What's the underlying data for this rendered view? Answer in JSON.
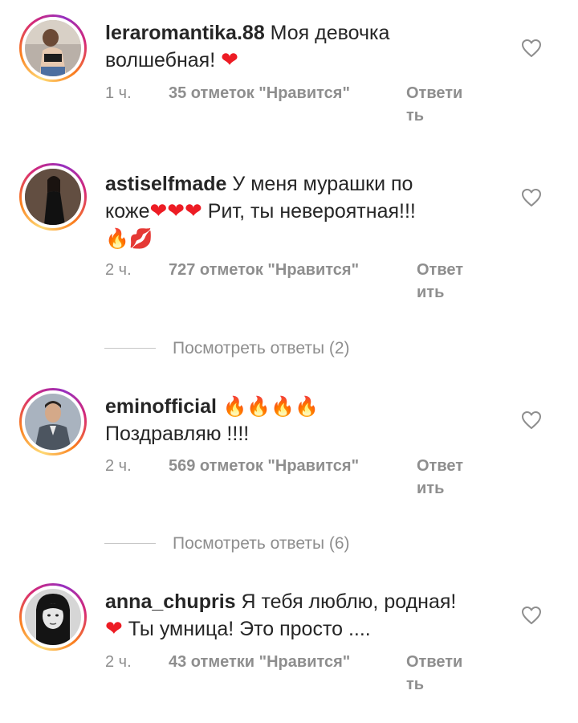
{
  "comments": [
    {
      "username": "leraromantika.88",
      "text_line1": " Моя девочка",
      "text_line2": "волшебная! ",
      "emoji_line2": "❤",
      "time": "1 ч.",
      "likes": "35 отметок \"Нравится\"",
      "reply_line1": "Ответи",
      "reply_line2": "ть"
    },
    {
      "username": "astiselfmade",
      "text_line1": " У меня мурашки по",
      "text_line2a": "коже",
      "emoji_line2": "❤❤❤",
      "text_line2b": " Рит, ты невероятная!!!",
      "emoji_line3": "🔥💋",
      "time": "2 ч.",
      "likes": "727 отметок \"Нравится\"",
      "reply_line1": "Ответ",
      "reply_line2": "ить"
    },
    {
      "username": "eminofficial",
      "emoji_line1": " 🔥🔥🔥🔥",
      "text_line2": "Поздравляю !!!!",
      "time": "2 ч.",
      "likes": "569 отметок \"Нравится\"",
      "reply_line1": "Ответ",
      "reply_line2": "ить"
    },
    {
      "username": "anna_chupris",
      "text_line1": " Я тебя люблю, родная!",
      "emoji_line2": "❤",
      "text_line2": " Ты умница! Это просто ....",
      "time": "2 ч.",
      "likes": "43 отметки \"Нравится\"",
      "reply_line1": "Ответи",
      "reply_line2": "ть"
    }
  ],
  "view_replies": [
    {
      "label": "Посмотреть ответы (2)"
    },
    {
      "label": "Посмотреть ответы (6)"
    }
  ],
  "icons": {
    "like": "heart-outline-icon"
  },
  "colors": {
    "heart": "#ed1c24",
    "meta": "#8e8e8e",
    "text": "#262626"
  }
}
